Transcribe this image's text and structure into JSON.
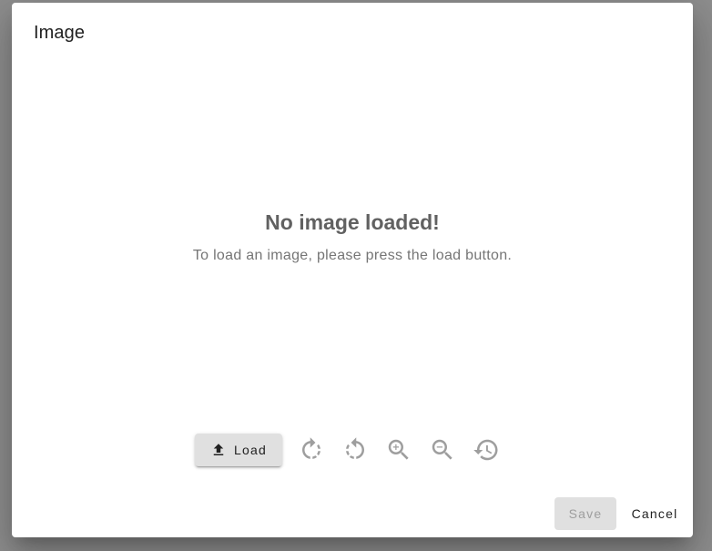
{
  "dialog": {
    "title": "Image"
  },
  "empty_state": {
    "title": "No image loaded!",
    "message": "To load an image, please press the load button."
  },
  "toolbar": {
    "load_label": "Load",
    "load_icon": "upload-icon",
    "tools": [
      {
        "name": "rotate-clockwise",
        "icon": "rotate-right-icon"
      },
      {
        "name": "rotate-counterclockwise",
        "icon": "rotate-left-icon"
      },
      {
        "name": "zoom-in",
        "icon": "zoom-in-icon"
      },
      {
        "name": "zoom-out",
        "icon": "zoom-out-icon"
      },
      {
        "name": "reset",
        "icon": "history-icon"
      }
    ]
  },
  "actions": {
    "save_label": "Save",
    "cancel_label": "Cancel"
  },
  "colors": {
    "backdrop": "#8e8e8e",
    "icon": "#9e9e9e",
    "button_bg": "#e0e0e0"
  }
}
